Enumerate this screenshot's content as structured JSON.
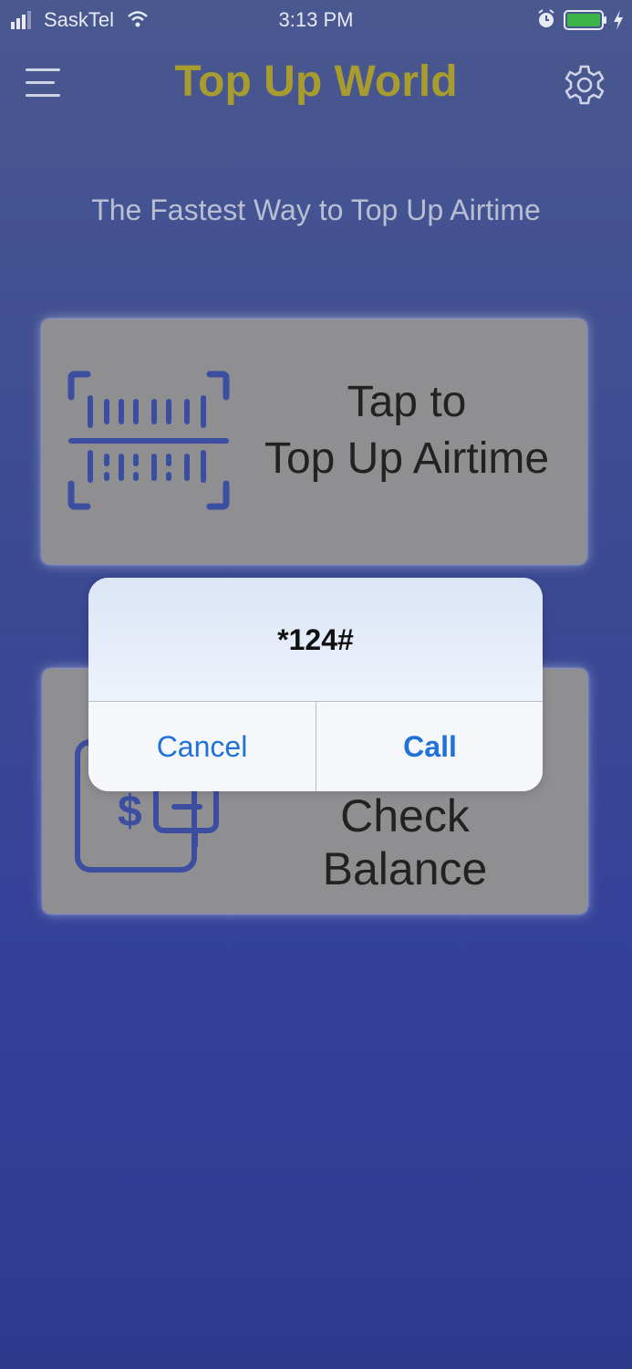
{
  "status_bar": {
    "carrier": "SaskTel",
    "time": "3:13 PM",
    "battery_color": "#3cb44a"
  },
  "header": {
    "title": "Top Up World",
    "title_color": "#a99c2e",
    "menu_icon": "hamburger-menu-icon",
    "settings_icon": "gear-icon"
  },
  "tagline": "The Fastest Way to Top Up Airtime",
  "cards": {
    "topup": {
      "line1": "Tap to",
      "line2": "Top Up Airtime",
      "icon": "barcode-scan-icon"
    },
    "balance": {
      "label": "Check Balance",
      "icon": "wallet-icon"
    }
  },
  "alert": {
    "message": "*124#",
    "cancel_label": "Cancel",
    "call_label": "Call",
    "button_color": "#1f72d8"
  }
}
